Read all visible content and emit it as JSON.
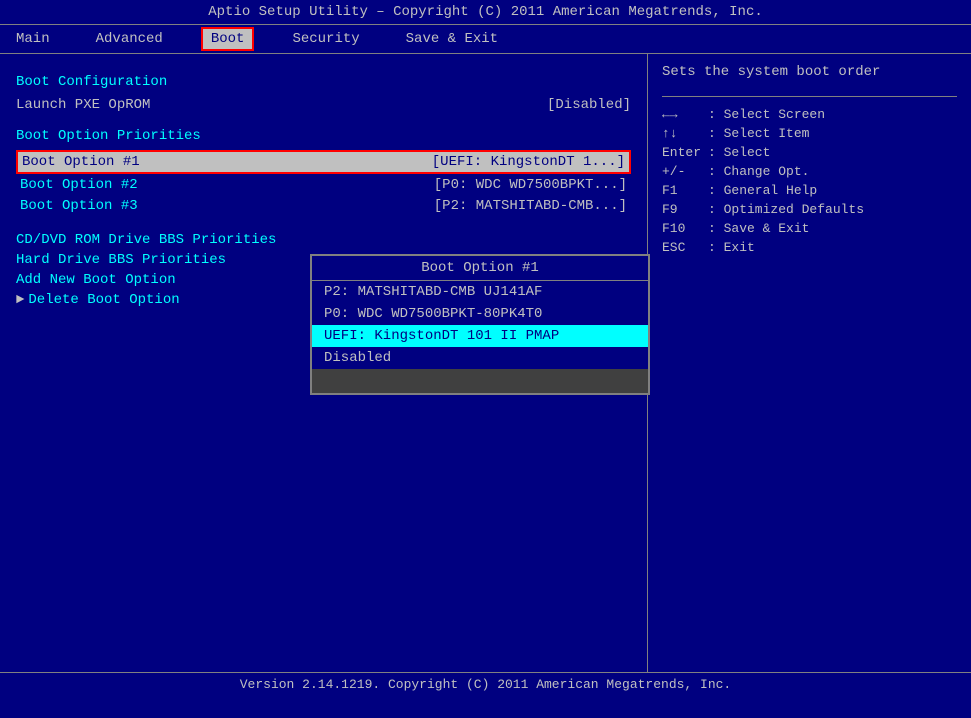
{
  "title_bar": {
    "text": "Aptio Setup Utility – Copyright (C) 2011 American Megatrends, Inc."
  },
  "menu": {
    "items": [
      {
        "id": "main",
        "label": "Main",
        "active": false
      },
      {
        "id": "advanced",
        "label": "Advanced",
        "active": false
      },
      {
        "id": "boot",
        "label": "Boot",
        "active": true
      },
      {
        "id": "security",
        "label": "Security",
        "active": false
      },
      {
        "id": "save_exit",
        "label": "Save & Exit",
        "active": false
      }
    ]
  },
  "left_panel": {
    "section1_title": "Boot Configuration",
    "launch_pxe_label": "Launch PXE OpROM",
    "launch_pxe_value": "[Disabled]",
    "section2_title": "Boot Option Priorities",
    "boot_options": [
      {
        "label": "Boot Option #1",
        "value": "[UEFI: KingstonDT 1...]",
        "selected": true
      },
      {
        "label": "Boot Option #2",
        "value": "[P0: WDC WD7500BPKT...]"
      },
      {
        "label": "Boot Option #3",
        "value": "[P2: MATSHITABD-CMB...]"
      }
    ],
    "menu_links": [
      {
        "label": "CD/DVD ROM Drive BBS Priorities",
        "arrow": false
      },
      {
        "label": "Hard Drive BBS Priorities",
        "arrow": false
      },
      {
        "label": "Add New Boot Option",
        "arrow": false
      },
      {
        "label": "Delete Boot Option",
        "arrow": true
      }
    ]
  },
  "dropdown": {
    "title": "Boot Option #1",
    "items": [
      {
        "label": "P2: MATSHITABD-CMB UJ141AF",
        "highlighted": false
      },
      {
        "label": "P0: WDC WD7500BPKT-80PK4T0",
        "highlighted": false
      },
      {
        "label": "UEFI: KingstonDT 101 II PMAP",
        "highlighted": true
      },
      {
        "label": "Disabled",
        "highlighted": false
      }
    ]
  },
  "right_panel": {
    "help_text": "Sets the system boot order",
    "key_hints": [
      {
        "key": "←→",
        "desc": ": Select Screen"
      },
      {
        "key": "↑↓",
        "desc": ": Select Item"
      },
      {
        "key": "Enter",
        "desc": ": Select"
      },
      {
        "key": "+/-",
        "desc": ": Change Opt."
      },
      {
        "key": "F1",
        "desc": ": General Help"
      },
      {
        "key": "F9",
        "desc": ": Optimized Defaults"
      },
      {
        "key": "F10",
        "desc": ": Save & Exit"
      },
      {
        "key": "ESC",
        "desc": ": Exit"
      }
    ]
  },
  "bottom_bar": {
    "text": "Version 2.14.1219. Copyright (C) 2011 American Megatrends, Inc."
  }
}
